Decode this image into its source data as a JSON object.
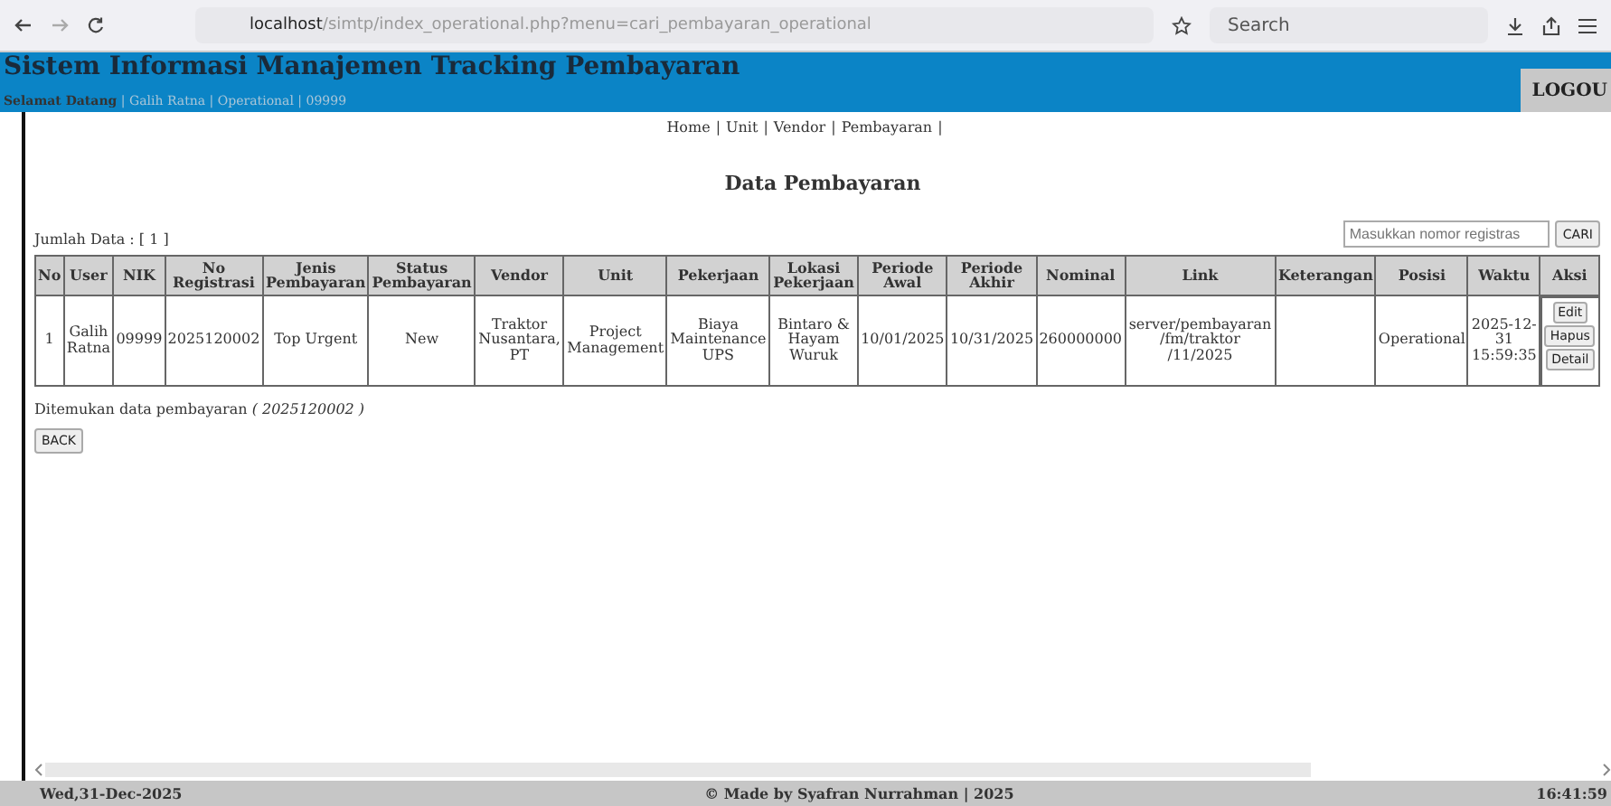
{
  "browser": {
    "url_host": "localhost",
    "url_path": "/simtp/index_operational.php?menu=cari_pembayaran_operational",
    "search_placeholder": "Search"
  },
  "header": {
    "title": "Sistem Informasi Manajemen Tracking Pembayaran",
    "welcome": "Selamat Datang",
    "user_info": "| Galih Ratna | Operational | 09999",
    "logout": "LOGOU"
  },
  "nav": [
    "Home",
    "Unit",
    "Vendor",
    "Pembayaran"
  ],
  "nav_separator": "|",
  "page_title": "Data Pembayaran",
  "count_label": "Jumlah Data : [ 1 ]",
  "search": {
    "placeholder": "Masukkan nomor registras",
    "button": "CARI"
  },
  "table": {
    "columns": [
      "No",
      "User",
      "NIK",
      "No Registrasi",
      "Jenis Pembayaran",
      "Status Pembayaran",
      "Vendor",
      "Unit",
      "Pekerjaan",
      "Lokasi Pekerjaan",
      "Periode Awal",
      "Periode Akhir",
      "Nominal",
      "Link",
      "Keterangan",
      "Posisi",
      "Waktu",
      "Aksi"
    ],
    "rows": [
      {
        "cells": [
          "1",
          "Galih Ratna",
          "09999",
          "2025120002",
          "Top Urgent",
          "New",
          "Traktor Nusantara, PT",
          "Project Management",
          "Biaya Maintenance UPS",
          "Bintaro & Hayam Wuruk",
          "10/01/2025",
          "10/31/2025",
          "260000000",
          "server/pembayaran /fm/traktor /11/2025",
          "",
          "Operational",
          "2025-12-31 15:59:35"
        ],
        "actions": [
          "Edit",
          "Hapus",
          "Detail"
        ]
      }
    ]
  },
  "result_text": "Ditemukan data pembayaran *( 2025120002 )*",
  "back_button": "BACK",
  "footer": {
    "date": "Wed,31-Dec-2025",
    "credit": "© Made by Syafran Nurrahman | 2025",
    "time": "16:41:59"
  }
}
